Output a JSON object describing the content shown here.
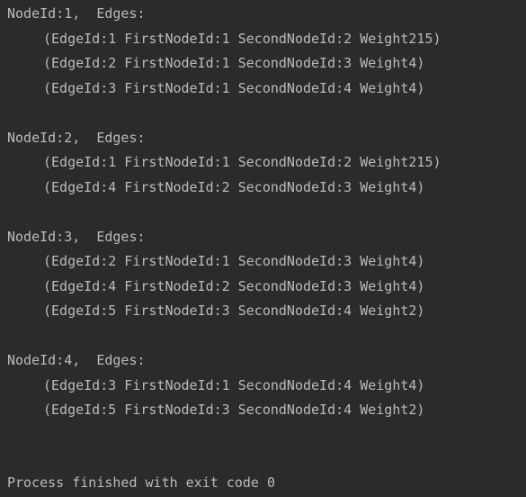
{
  "output": {
    "nodes": [
      {
        "header": "NodeId:1,  Edges:",
        "edges": [
          "(EdgeId:1 FirstNodeId:1 SecondNodeId:2 Weight215)",
          "(EdgeId:2 FirstNodeId:1 SecondNodeId:3 Weight4)",
          "(EdgeId:3 FirstNodeId:1 SecondNodeId:4 Weight4)"
        ]
      },
      {
        "header": "NodeId:2,  Edges:",
        "edges": [
          "(EdgeId:1 FirstNodeId:1 SecondNodeId:2 Weight215)",
          "(EdgeId:4 FirstNodeId:2 SecondNodeId:3 Weight4)"
        ]
      },
      {
        "header": "NodeId:3,  Edges:",
        "edges": [
          "(EdgeId:2 FirstNodeId:1 SecondNodeId:3 Weight4)",
          "(EdgeId:4 FirstNodeId:2 SecondNodeId:3 Weight4)",
          "(EdgeId:5 FirstNodeId:3 SecondNodeId:4 Weight2)"
        ]
      },
      {
        "header": "NodeId:4,  Edges:",
        "edges": [
          "(EdgeId:3 FirstNodeId:1 SecondNodeId:4 Weight4)",
          "(EdgeId:5 FirstNodeId:3 SecondNodeId:4 Weight2)"
        ]
      }
    ],
    "exit_message": "Process finished with exit code 0"
  },
  "colors": {
    "background": "#2b2b2b",
    "text": "#bbbbbb"
  }
}
